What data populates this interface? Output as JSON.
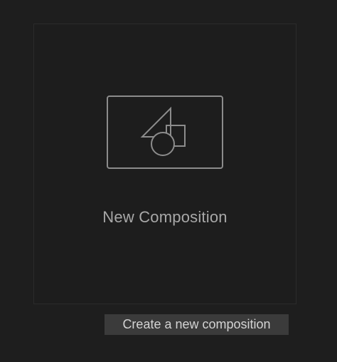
{
  "new_composition_card": {
    "label": "New Composition",
    "icon": "composition-shapes-icon"
  },
  "tooltip": {
    "text": "Create a new composition"
  },
  "colors": {
    "background": "#1e1e1e",
    "card_border": "#2b2b2b",
    "icon_stroke": "#8c8c8c",
    "label_text": "#a8a8a8",
    "tooltip_background": "#3b3b3b",
    "tooltip_text": "#d4d4d4"
  }
}
